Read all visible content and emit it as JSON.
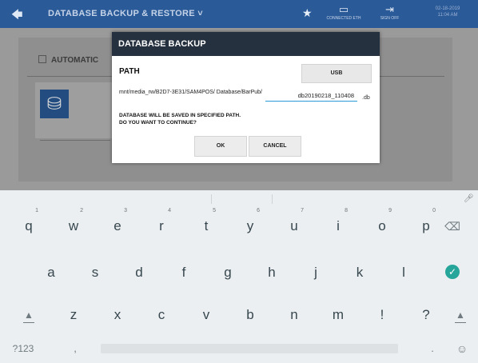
{
  "topbar": {
    "back_icon": "arrow-left-icon",
    "title": "DATABASE BACKUP & RESTORE ˅",
    "star_icon": "star-icon",
    "connected_label": "CONNECTED ETH",
    "signoff_label": "SIGN OFF",
    "date": "02-18-2019",
    "time": "11:04 AM",
    "color": "#2a5a98"
  },
  "background": {
    "automatic_label": "AUTOMATIC"
  },
  "dialog": {
    "title": "DATABASE BACKUP",
    "path_label": "PATH",
    "usb_label": "USB",
    "path_value": "mnt/media_rw/B2D7-3E31/SAM4POS/ Database/BarPub/",
    "filename_value": "db20190218_110408",
    "extension": ".db",
    "message_line1": "DATABASE WILL BE SAVED IN SPECIFIED PATH.",
    "message_line2": "DO YOU WANT TO CONTINUE?",
    "ok_label": "OK",
    "cancel_label": "CANCEL"
  },
  "keyboard": {
    "row1": [
      "q",
      "w",
      "e",
      "r",
      "t",
      "y",
      "u",
      "i",
      "o",
      "p"
    ],
    "row1_hints": [
      "1",
      "2",
      "3",
      "4",
      "5",
      "6",
      "7",
      "8",
      "9",
      "0"
    ],
    "row2": [
      "a",
      "s",
      "d",
      "f",
      "g",
      "h",
      "j",
      "k",
      "l"
    ],
    "row3": [
      "z",
      "x",
      "c",
      "v",
      "b",
      "n",
      "m",
      "!",
      "?"
    ],
    "symbols_label": "?123",
    "comma_label": ",",
    "period_label": ".",
    "backspace_icon": "backspace-icon",
    "enter_icon": "checkmark-icon",
    "shift_icon": "shift-icon",
    "emoji_icon": "emoji-icon",
    "mic_icon": "microphone-icon",
    "accent_color": "#26a69a"
  }
}
